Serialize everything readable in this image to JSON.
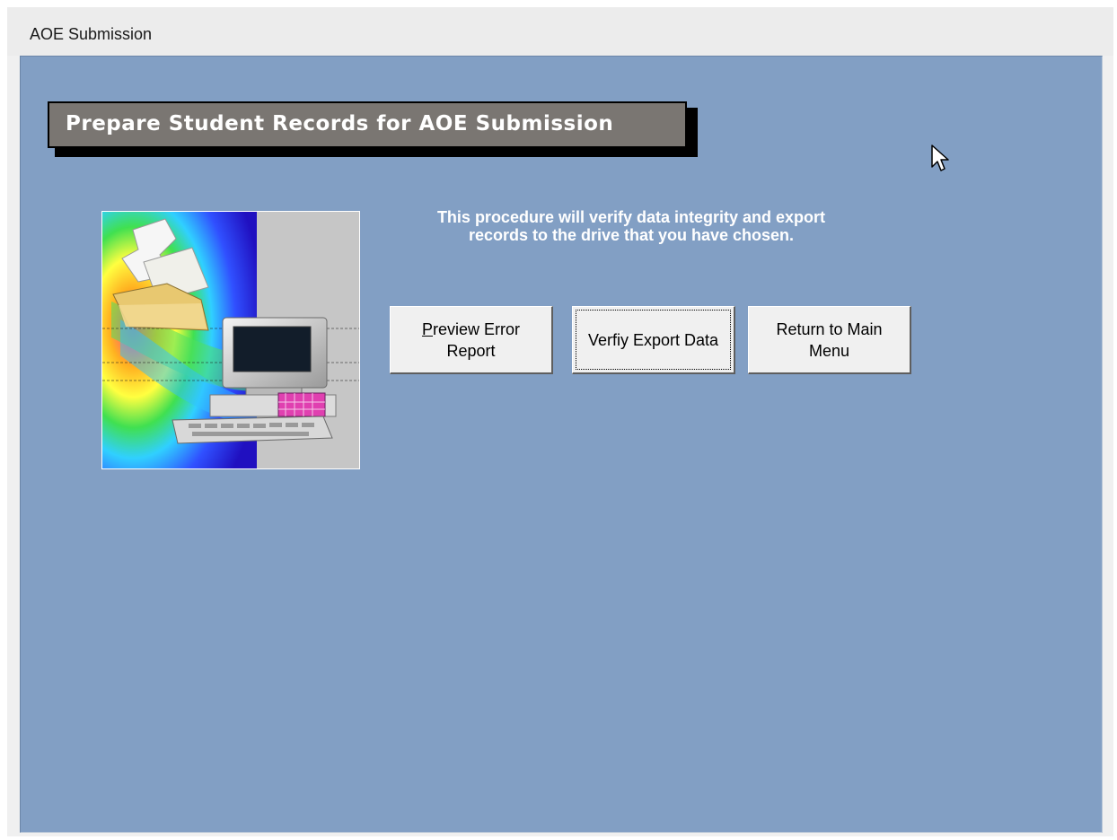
{
  "window": {
    "title": "AOE Submission"
  },
  "banner": {
    "text": "Prepare Student Records for AOE Submission"
  },
  "description": {
    "line1": "This procedure will verify data integrity and export",
    "line2": "records to the drive that you have chosen."
  },
  "buttons": {
    "preview": {
      "accel": "P",
      "rest_line1": "review Error",
      "line2": "Report"
    },
    "verify": {
      "label": "Verfiy Export Data"
    },
    "return": {
      "line1": "Return to Main",
      "line2": "Menu"
    }
  },
  "icons": {
    "illustration": "computer-documents-illustration",
    "cursor": "mouse-pointer-icon"
  },
  "colors": {
    "client_background": "#829fc4",
    "banner_background": "#7a7672",
    "banner_text": "#ffffff",
    "button_face": "#f0f0f0"
  }
}
